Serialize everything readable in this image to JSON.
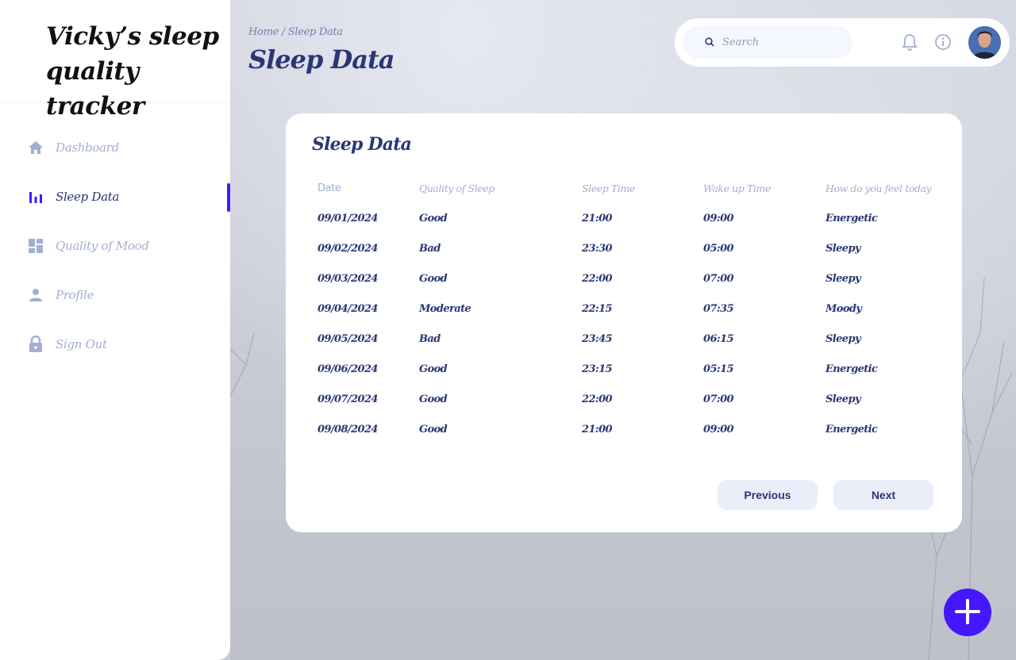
{
  "app": {
    "title": "Vicky's sleep quality tracker",
    "title_line1": "Vicky’s sleep",
    "title_line2": "quality tracker"
  },
  "sidebar": {
    "items": [
      {
        "label": "Dashboard",
        "icon": "home-icon",
        "active": false
      },
      {
        "label": "Sleep Data",
        "icon": "bar-chart-icon",
        "active": true
      },
      {
        "label": "Quality of Mood",
        "icon": "dashboard-grid-icon",
        "active": false
      },
      {
        "label": "Profile",
        "icon": "person-icon",
        "active": false
      },
      {
        "label": "Sign Out",
        "icon": "lock-icon",
        "active": false
      }
    ]
  },
  "header": {
    "breadcrumb": "Home / Sleep Data",
    "title": "Sleep Data",
    "search_placeholder": "Search"
  },
  "card": {
    "title": "Sleep Data",
    "columns": [
      "Date",
      "Quality of Sleep",
      "Sleep Time",
      "Wake up Time",
      "How do you feel today"
    ],
    "rows": [
      [
        "09/01/2024",
        "Good",
        "21:00",
        "09:00",
        "Energetic"
      ],
      [
        "09/02/2024",
        "Bad",
        "23:30",
        "05:00",
        "Sleepy"
      ],
      [
        "09/03/2024",
        "Good",
        "22:00",
        "07:00",
        "Sleepy"
      ],
      [
        "09/04/2024",
        "Moderate",
        "22:15",
        "07:35",
        "Moody"
      ],
      [
        "09/05/2024",
        "Bad",
        "23:45",
        "06:15",
        "Sleepy"
      ],
      [
        "09/06/2024",
        "Good",
        "23:15",
        "05:15",
        "Energetic"
      ],
      [
        "09/07/2024",
        "Good",
        "22:00",
        "07:00",
        "Sleepy"
      ],
      [
        "09/08/2024",
        "Good",
        "21:00",
        "09:00",
        "Energetic"
      ]
    ],
    "prev_label": "Previous",
    "next_label": "Next"
  },
  "colors": {
    "accent": "#4318ff",
    "text_primary": "#2b3674",
    "text_muted": "#a3aed0"
  }
}
